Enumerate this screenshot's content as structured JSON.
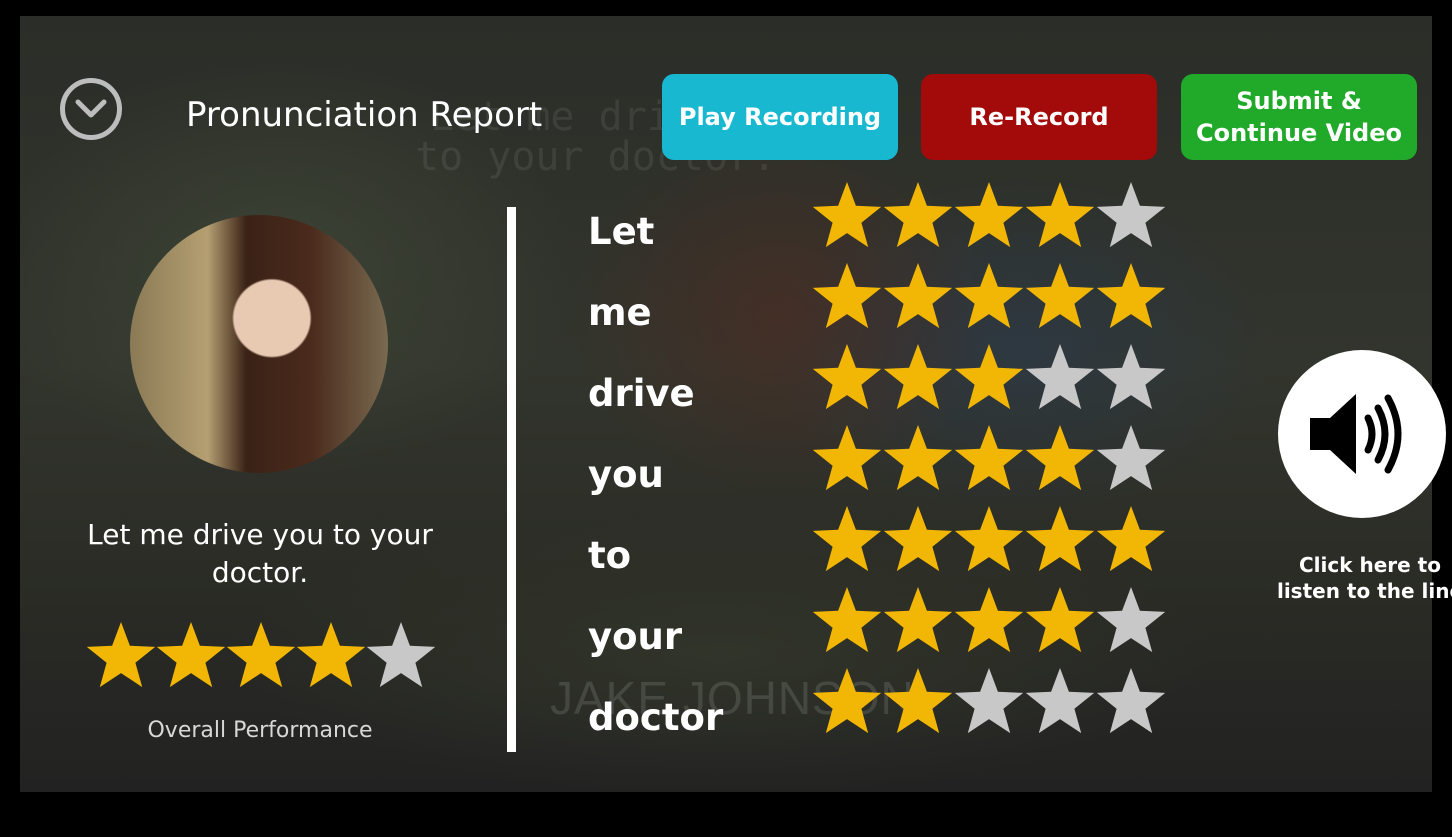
{
  "header": {
    "title": "Pronunciation Report",
    "play_label": "Play Recording",
    "rerecord_label": "Re-Record",
    "submit_label": "Submit &\nContinue Video"
  },
  "background": {
    "subtitle_line1": "Let me drive",
    "subtitle_line2": "to your doctor.",
    "credit": "JAKE JOHNSON"
  },
  "summary": {
    "sentence": "Let me drive you to your doctor.",
    "overall_rating": 4,
    "overall_label": "Overall Performance"
  },
  "words": [
    {
      "word": "Let",
      "rating": 4
    },
    {
      "word": "me",
      "rating": 5
    },
    {
      "word": "drive",
      "rating": 3
    },
    {
      "word": "you",
      "rating": 4
    },
    {
      "word": "to",
      "rating": 5
    },
    {
      "word": "your",
      "rating": 4
    },
    {
      "word": "doctor",
      "rating": 2
    }
  ],
  "max_rating": 5,
  "speaker": {
    "label": "Click here to\nlisten to the line"
  },
  "colors": {
    "star_filled": "#f2b705",
    "star_empty": "#c8c8c8",
    "play": "#18b8d0",
    "rerecord": "#a30a0a",
    "submit": "#21a92a"
  }
}
